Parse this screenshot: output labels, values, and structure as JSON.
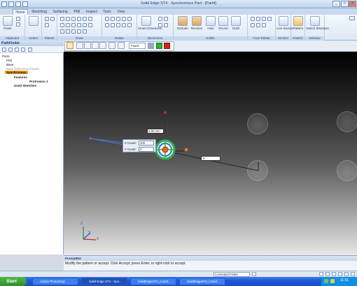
{
  "window": {
    "title": "Solid Edge ST4 - Synchronous Part - [Part4]"
  },
  "ribbon_tabs": [
    {
      "label": "Home"
    },
    {
      "label": "Sketching"
    },
    {
      "label": "Surfacing"
    },
    {
      "label": "PMI"
    },
    {
      "label": "Inspect"
    },
    {
      "label": "Tools"
    },
    {
      "label": "View"
    }
  ],
  "ribbon_groups": [
    {
      "label": "Clipboard"
    },
    {
      "label": "Select"
    },
    {
      "label": "Planes"
    },
    {
      "label": "Draw"
    },
    {
      "label": "Relate"
    },
    {
      "label": "Dimension"
    },
    {
      "label": "Solids"
    },
    {
      "label": "Face Relate"
    },
    {
      "label": "Section"
    },
    {
      "label": "Pattern"
    },
    {
      "label": "Window"
    }
  ],
  "ribbon_buttons": {
    "paste": "Paste",
    "smart_dimension": "Smart Dimension",
    "extrude": "Extrude",
    "revolve": "Revolve",
    "hole": "Hole",
    "round": "Round",
    "draft": "Draft",
    "live_section": "Live Section",
    "pattern": "Pattern",
    "switch_windows": "Switch Windows"
  },
  "pathfinder": {
    "title": "PathFinder",
    "items": [
      {
        "label": "Part4"
      },
      {
        "label": "PMI"
      },
      {
        "label": "Base"
      },
      {
        "label": "Base Reference Planes"
      },
      {
        "label": "Synchronous"
      },
      {
        "label": "Features"
      },
      {
        "label": "Protrusion 1"
      },
      {
        "label": "Used Sketches"
      }
    ]
  },
  "command_bar": {
    "fit_option": "Fixed"
  },
  "viewport": {
    "dimension_value": "6.00 mm",
    "x_count_label": "X Count:",
    "x_count_value": "100",
    "y_count_label": "Y Count:",
    "y_count_value": "2",
    "spacing_value": "6"
  },
  "axes": {
    "x": "X",
    "y": "Y",
    "z": "Z"
  },
  "prompt": {
    "title": "PromptBar",
    "message": "Modify the pattern or accept.  Click Accept, press Enter, or right-click to accept."
  },
  "status": {
    "command_finder": "Command Finder"
  },
  "taskbar": {
    "start": "Start",
    "tasks": [
      {
        "label": "Adobe Photoshop"
      },
      {
        "label": "Solid Edge ST4 - Syn..."
      },
      {
        "label": "SolidEdgeST3_install..."
      },
      {
        "label": "SolidEdgeST3_install..."
      }
    ],
    "clock": "11:51"
  },
  "colors": {
    "accept": "#2bb32b",
    "cancel": "#d22222",
    "selection": "#f5a623",
    "xp_start": "#3c9b34"
  }
}
